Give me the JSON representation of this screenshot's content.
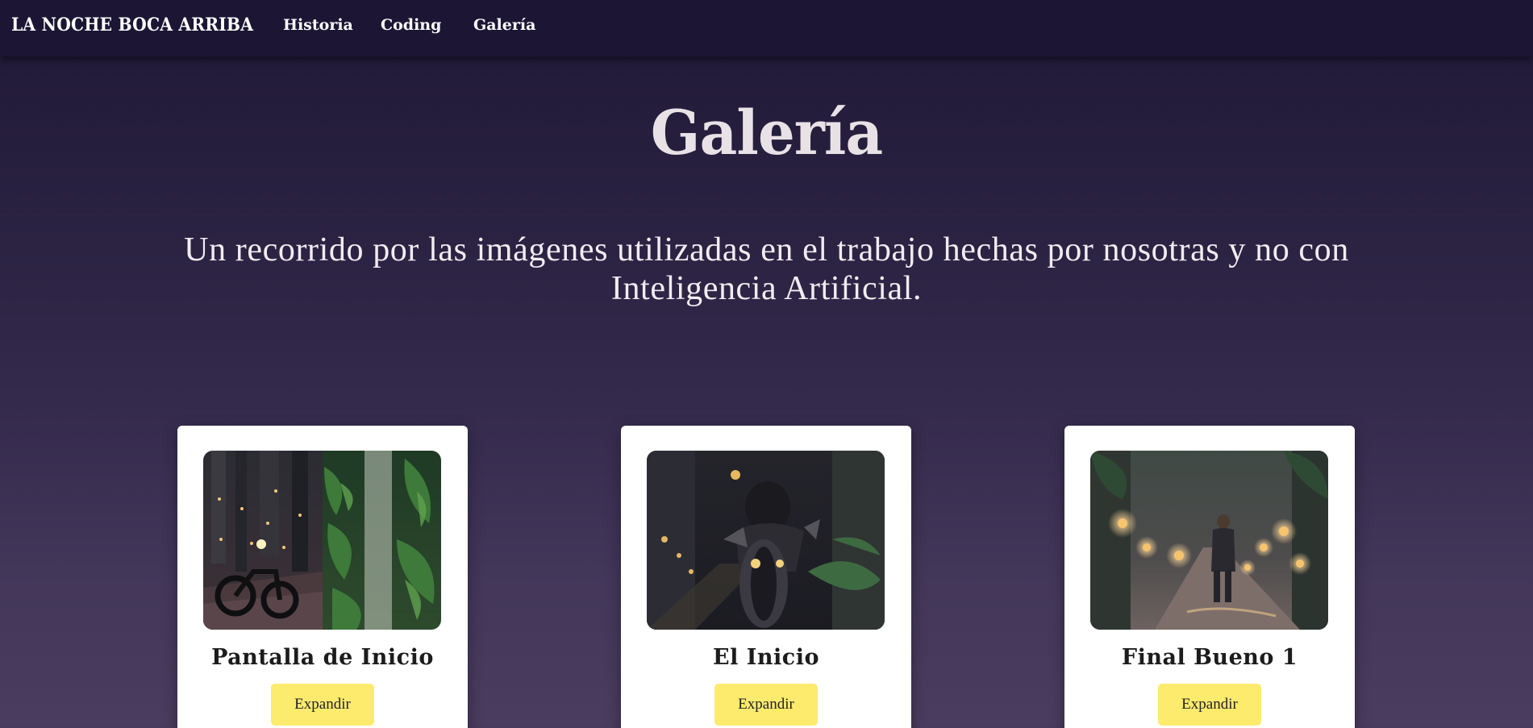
{
  "nav": {
    "brand": "LA NOCHE BOCA ARRIBA",
    "links": [
      {
        "label": "Historia"
      },
      {
        "label": "Coding"
      },
      {
        "label": "Galería"
      }
    ]
  },
  "page": {
    "title": "Galería",
    "subtitle": "Un recorrido por las imágenes utilizadas en el trabajo hechas por nosotras y no con Inteligencia Artificial."
  },
  "gallery": {
    "cards": [
      {
        "title": "Pantalla de Inicio",
        "button": "Expandir",
        "image": "night-street-motorcycle-jungle-painting"
      },
      {
        "title": "El Inicio",
        "button": "Expandir",
        "image": "motorcyclist-riding-at-night-painting"
      },
      {
        "title": "Final Bueno 1",
        "button": "Expandir",
        "image": "man-walking-lantern-street-painting"
      }
    ]
  },
  "colors": {
    "navbar": "#1c1634",
    "background_top": "#1f1836",
    "background_bottom": "#4a3c5e",
    "card": "#ffffff",
    "button": "#fdeb6e"
  }
}
